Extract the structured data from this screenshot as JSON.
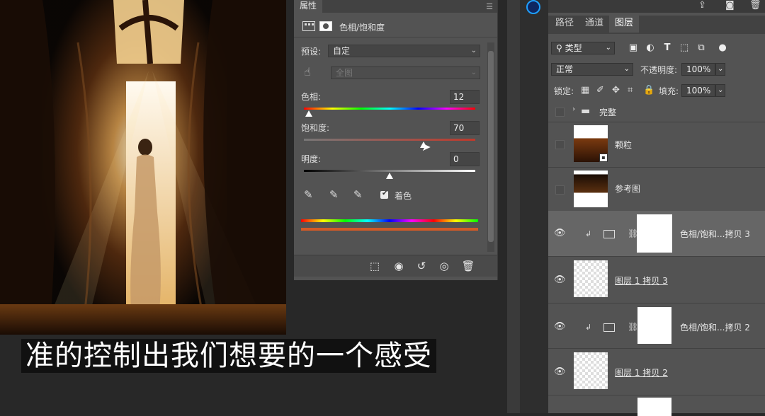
{
  "properties": {
    "tab": "属性",
    "adjustment_title": "色相/饱和度",
    "preset_label": "预设:",
    "preset_value": "自定",
    "channel_value": "全图",
    "hue_label": "色相:",
    "hue_value": "12",
    "saturation_label": "饱和度:",
    "saturation_value": "70",
    "lightness_label": "明度:",
    "lightness_value": "0",
    "colorize_label": "着色",
    "colorize_checked": true
  },
  "subtitle": "准的控制出我们想要的一个感受",
  "layers_panel": {
    "tabs": [
      "路径",
      "通道",
      "图层"
    ],
    "filter_kind": "类型",
    "blend_mode": "正常",
    "opacity_label": "不透明度:",
    "opacity_value": "100%",
    "lock_label": "锁定:",
    "fill_label": "填充:",
    "fill_value": "100%",
    "layers": [
      {
        "name": "完整",
        "type": "group",
        "visible": false
      },
      {
        "name": "颗粒",
        "type": "smart",
        "visible": false
      },
      {
        "name": "参考图",
        "type": "image",
        "visible": false
      },
      {
        "name": "色相/饱和...拷贝 3",
        "type": "adjustment",
        "visible": true,
        "selected": true
      },
      {
        "name": "图层 1 拷贝 3",
        "type": "pixel",
        "visible": true
      },
      {
        "name": "色相/饱和...拷贝 2",
        "type": "adjustment",
        "visible": true
      },
      {
        "name": "图层 1 拷贝 2",
        "type": "pixel",
        "visible": true
      }
    ]
  },
  "icons": {
    "colors": {
      "panel": "#535353",
      "dark": "#282828",
      "accent": "#1ea0ff"
    }
  }
}
